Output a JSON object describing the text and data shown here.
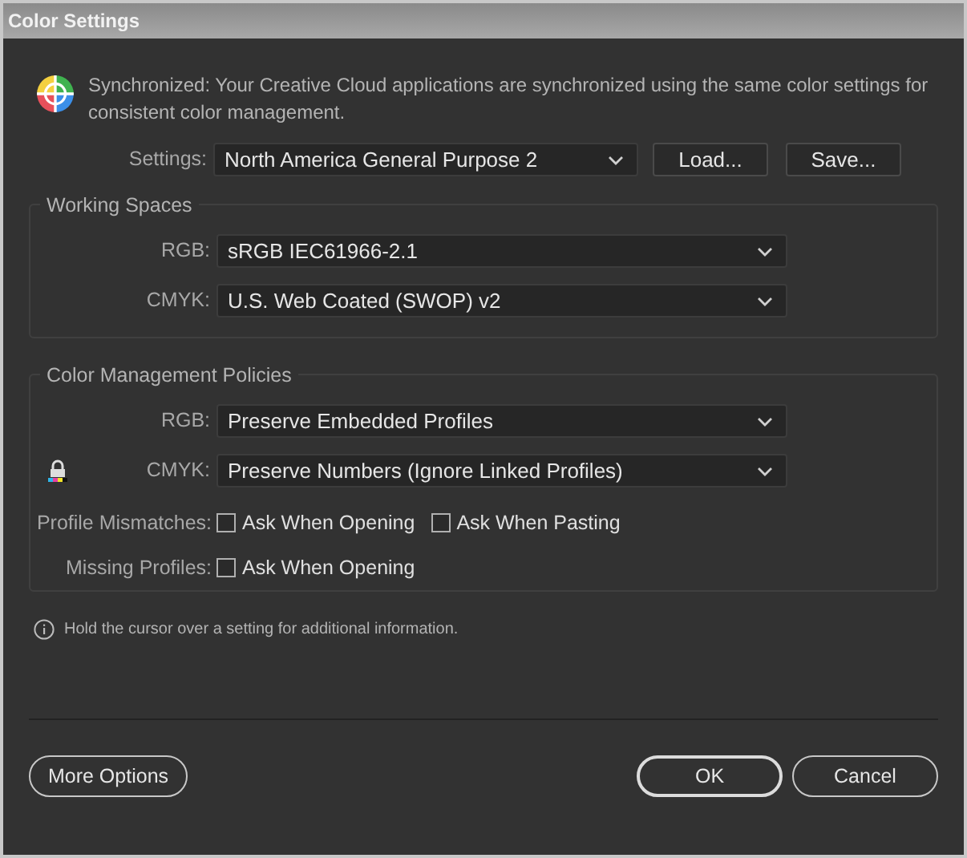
{
  "window": {
    "title": "Color Settings"
  },
  "sync_message": "Synchronized: Your Creative Cloud applications are synchronized using the same color settings for consistent color management.",
  "settings": {
    "label": "Settings:",
    "value": "North America General Purpose 2",
    "buttons": [
      "Load...",
      "Save..."
    ]
  },
  "working_spaces": {
    "title": "Working Spaces",
    "rows": [
      {
        "label": "RGB:",
        "value": "sRGB IEC61966-2.1"
      },
      {
        "label": "CMYK:",
        "value": "U.S. Web Coated (SWOP) v2"
      }
    ]
  },
  "policies": {
    "title": "Color Management Policies",
    "rows": [
      {
        "label": "RGB:",
        "value": "Preserve Embedded Profiles",
        "locked": false
      },
      {
        "label": "CMYK:",
        "value": "Preserve Numbers (Ignore Linked Profiles)",
        "locked": true
      }
    ],
    "checks": [
      {
        "label": "Profile Mismatches:",
        "options": [
          {
            "label": "Ask When Opening",
            "checked": false
          },
          {
            "label": "Ask When Pasting",
            "checked": false
          }
        ]
      },
      {
        "label": "Missing Profiles:",
        "options": [
          {
            "label": "Ask When Opening",
            "checked": false
          }
        ]
      }
    ]
  },
  "info": "Hold the cursor over a setting for additional information.",
  "footer": {
    "left": [
      {
        "label": "More Options",
        "default": false
      }
    ],
    "right": [
      {
        "label": "OK",
        "default": true
      },
      {
        "label": "Cancel",
        "default": false
      }
    ]
  }
}
